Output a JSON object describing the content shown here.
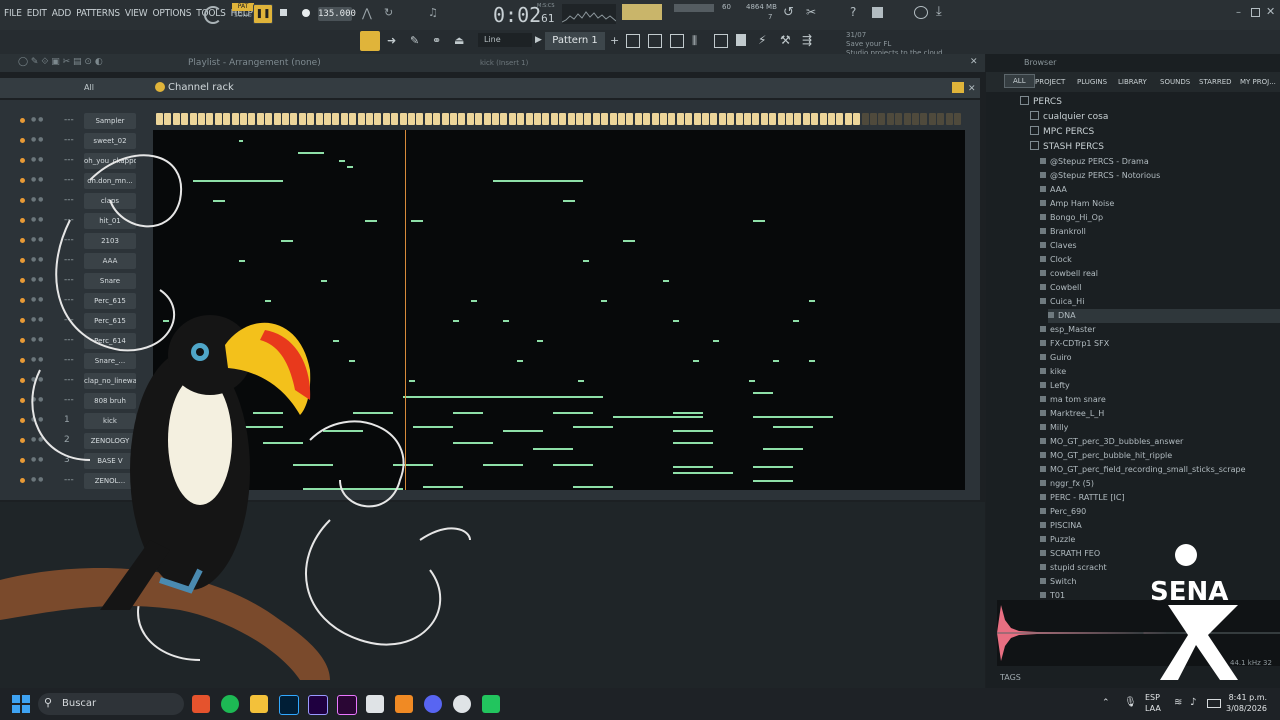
{
  "menu": [
    "FILE",
    "EDIT",
    "ADD",
    "PATTERNS",
    "VIEW",
    "OPTIONS",
    "TOOLS",
    "HELP"
  ],
  "transport": {
    "mode_pat": "PAT",
    "mode_song": "SONG",
    "tempo": "135.000",
    "time": "0:02",
    "time_sub": "61",
    "time_label": "M:S:CS",
    "memory": "4864 MB",
    "cpu_val": "60",
    "poly": "7"
  },
  "toolbar": {
    "snap": "Line",
    "pattern": "Pattern 1",
    "notice_date": "31/07",
    "notice_line1": "Save your FL",
    "notice_line2": "Studio projects to the cloud"
  },
  "playlist": {
    "title": "Playlist - Arrangement",
    "subtitle": "(none)",
    "extra": "kick (Insert 1)"
  },
  "channel_rack": {
    "title": "Channel rack",
    "filter": "All",
    "channels": [
      {
        "num": "---",
        "name": "Sampler"
      },
      {
        "num": "---",
        "name": "sweet_02"
      },
      {
        "num": "---",
        "name": "oh_you_ckappo"
      },
      {
        "num": "---",
        "name": "oh.don_mn..."
      },
      {
        "num": "---",
        "name": "claps"
      },
      {
        "num": "---",
        "name": "hit_01"
      },
      {
        "num": "---",
        "name": "2103"
      },
      {
        "num": "---",
        "name": "AAA"
      },
      {
        "num": "---",
        "name": "Snare"
      },
      {
        "num": "---",
        "name": "Perc_615"
      },
      {
        "num": "---",
        "name": "Perc_615"
      },
      {
        "num": "---",
        "name": "Perc_614"
      },
      {
        "num": "---",
        "name": "Snare_..."
      },
      {
        "num": "---",
        "name": "clap_no_linewar"
      },
      {
        "num": "---",
        "name": "808 bruh"
      },
      {
        "num": "1",
        "name": "kick"
      },
      {
        "num": "2",
        "name": "ZENOLOGY"
      },
      {
        "num": "3",
        "name": "BASE V"
      },
      {
        "num": "---",
        "name": "ZENOL..."
      }
    ]
  },
  "browser": {
    "title": "Browser",
    "tabs": [
      "ALL",
      "PROJECT",
      "PLUGINS",
      "LIBRARY",
      "SOUNDS",
      "STARRED",
      "MY PROJ..."
    ],
    "folders": [
      "PERCS",
      "cualquier cosa",
      "MPC PERCS",
      "STASH PERCS"
    ],
    "items": [
      "@Stepuz PERCS - Drama",
      "@Stepuz PERCS - Notorious",
      "AAA",
      "Amp Ham Noise",
      "Bongo_Hi_Op",
      "Brankroll",
      "Claves",
      "Clock",
      "cowbell real",
      "Cowbell",
      "Cuica_Hi",
      "DNA",
      "esp_Master",
      "FX-CDTrp1 SFX",
      "Guiro",
      "kike",
      "Lefty",
      "ma tom snare",
      "Marktree_L_H",
      "Milly",
      "MO_GT_perc_3D_bubbles_answer",
      "MO_GT_perc_bubble_hit_ripple",
      "MO_GT_perc_field_recording_small_sticks_scrape",
      "nggr_fx (5)",
      "PERC - RATTLE [IC]",
      "Perc_690",
      "PISCINA",
      "Puzzle",
      "SCRATH FEO",
      "stupid scracht",
      "Switch",
      "T01"
    ],
    "tags_label": "TAGS",
    "sample_rate": "44.1 kHz 32"
  },
  "taskbar": {
    "search_placeholder": "Buscar",
    "lang1": "ESP",
    "lang2": "LAA",
    "time": "8:41 p.m.",
    "date": "3/08/2026"
  },
  "logo_text": "SENA",
  "colors": {
    "accent": "#ecd59a",
    "note": "#8ee0a8",
    "cursor": "#d68a3a",
    "led": "#e89a36"
  }
}
